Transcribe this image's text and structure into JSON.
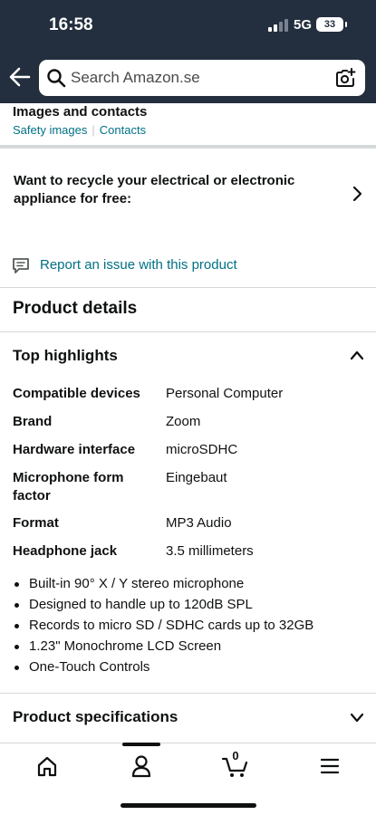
{
  "status_bar": {
    "time": "16:58",
    "network": "5G",
    "battery": "33"
  },
  "search": {
    "placeholder": "Search Amazon.se",
    "icons": [
      "back-arrow-icon",
      "search-icon",
      "camera-icon"
    ]
  },
  "images_section": {
    "title": "Images and contacts",
    "links": [
      "Safety images",
      "Contacts"
    ]
  },
  "recycle": {
    "text": "Want to recycle your electrical or electronic appliance for free:"
  },
  "report": {
    "label": "Report an issue with this product"
  },
  "product_details": {
    "title": "Product details",
    "top_highlights": {
      "title": "Top highlights",
      "specs": [
        {
          "key": "Compatible devices",
          "value": "Personal Computer"
        },
        {
          "key": "Brand",
          "value": "Zoom"
        },
        {
          "key": "Hardware interface",
          "value": "microSDHC"
        },
        {
          "key": "Microphone form factor",
          "value": "Eingebaut"
        },
        {
          "key": "Format",
          "value": "MP3 Audio"
        },
        {
          "key": "Headphone jack",
          "value": "3.5 millimeters"
        }
      ],
      "bullets": [
        "Built-in 90° X / Y stereo microphone",
        "Designed to handle up to 120dB SPL",
        "Records to micro SD / SDHC cards up to 32GB",
        "1.23\" Monochrome LCD Screen",
        "One-Touch Controls"
      ]
    },
    "product_specifications": {
      "title": "Product specifications"
    }
  },
  "bottom_nav": {
    "cart_count": "0",
    "items": [
      "home-icon",
      "account-icon",
      "cart-icon",
      "menu-icon"
    ]
  },
  "colors": {
    "header_bg": "#232f3e",
    "link": "#007185",
    "text": "#0f1111",
    "divider": "#d5d9d9"
  }
}
